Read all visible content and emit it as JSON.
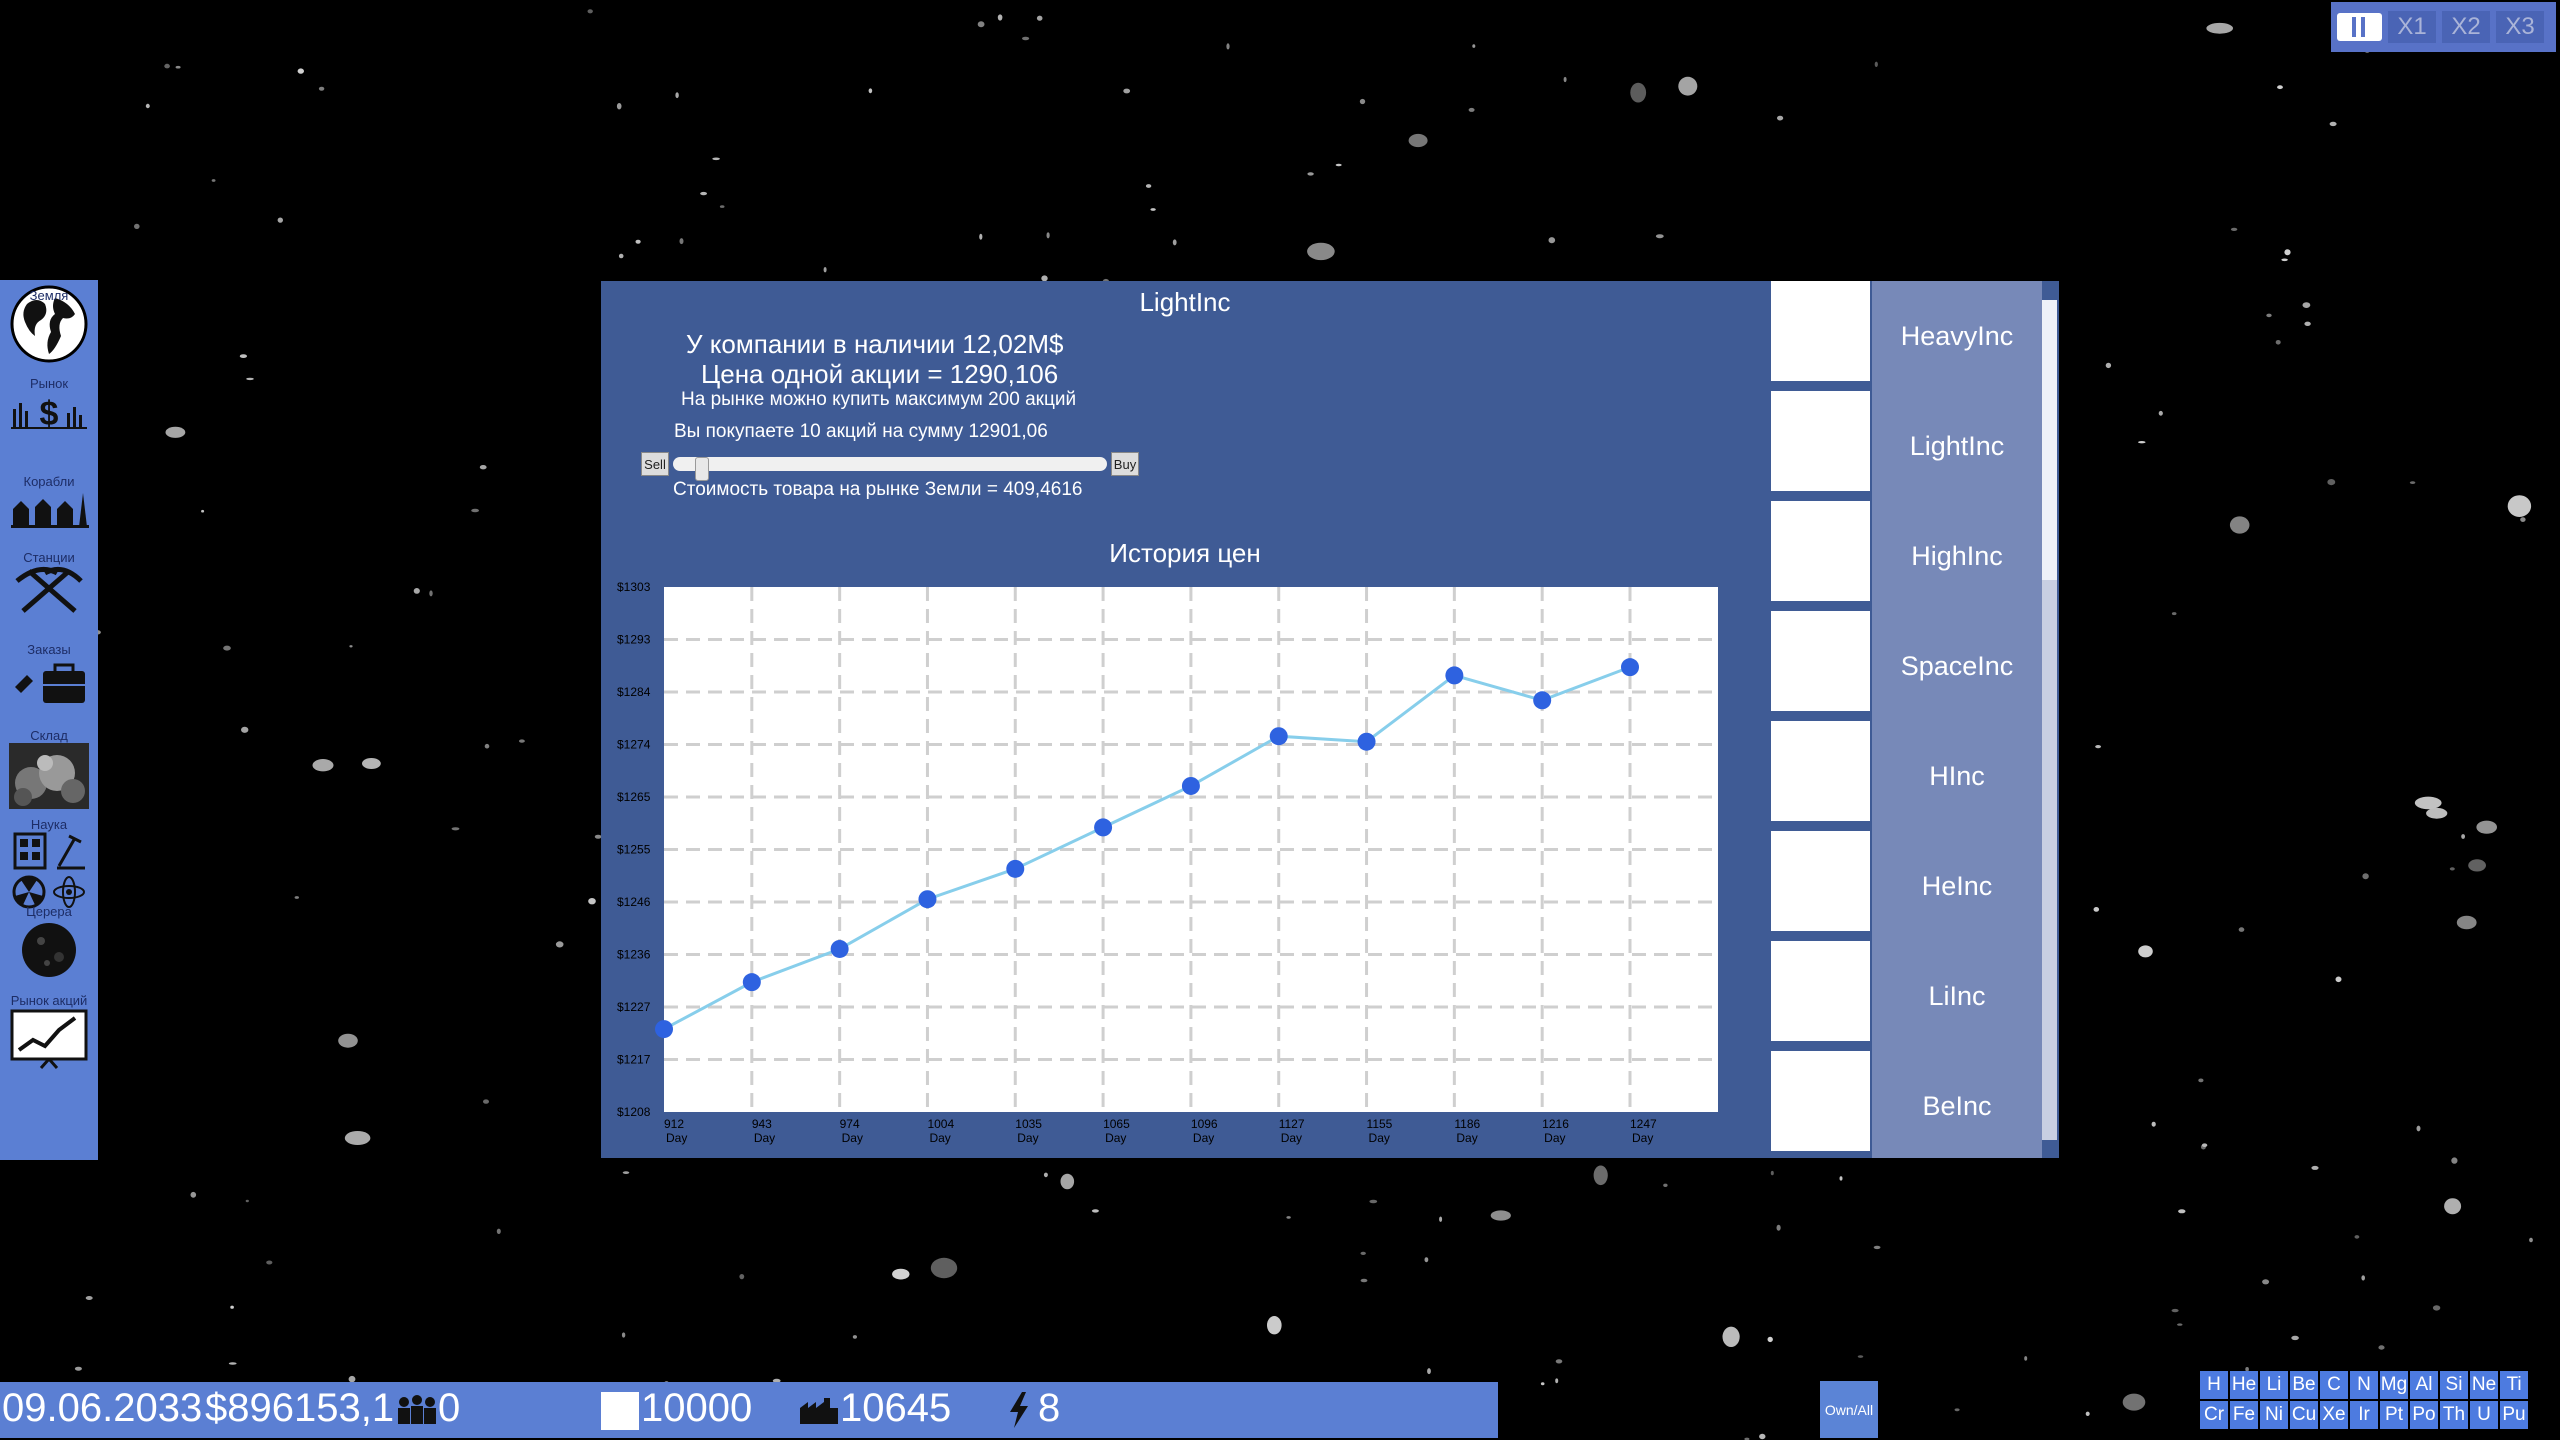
{
  "speed_controls": {
    "pause_icon": "pause-icon",
    "x1": "X1",
    "x2": "X2",
    "x3": "X3"
  },
  "sidebar": {
    "items": [
      {
        "label": "Земля",
        "icon": "globe-icon"
      },
      {
        "label": "Рынок",
        "icon": "market-icon"
      },
      {
        "label": "Корабли",
        "icon": "ships-icon"
      },
      {
        "label": "Станции",
        "icon": "mining-tools-icon"
      },
      {
        "label": "Заказы",
        "icon": "briefcase-icon"
      },
      {
        "label": "Склад",
        "icon": "warehouse-icon"
      },
      {
        "label": "Наука",
        "icon": "science-icon"
      },
      {
        "label": "Церера",
        "icon": "ceres-icon"
      },
      {
        "label": "Рынок акций",
        "icon": "stock-chart-icon"
      }
    ]
  },
  "panel": {
    "title": "LightInc",
    "cash_line": "У компании в наличии 12,02M$",
    "price_line": "Цена одной акции = 1290,106",
    "max_line": "На рынке можно купить максимум 200 акций",
    "buy_line": "Вы покупаете 10 акций на сумму 12901,06",
    "sell_label": "Sell",
    "buy_label": "Buy",
    "slider_fraction": 0.05,
    "earth_line": "Стоимость товара на рынке Земли = 409,4616",
    "chart_title": "История цен"
  },
  "chart_data": {
    "type": "line",
    "title": "История цен",
    "x_ticks": [
      "912",
      "943",
      "974",
      "1004",
      "1035",
      "1065",
      "1096",
      "1127",
      "1155",
      "1186",
      "1216",
      "1247"
    ],
    "x_unit": "Day",
    "y_ticks": [
      "$1208",
      "$1217",
      "$1227",
      "$1236",
      "$1246",
      "$1255",
      "$1265",
      "$1274",
      "$1284",
      "$1293",
      "$1303"
    ],
    "ylim": [
      1208,
      1303
    ],
    "x": [
      912,
      943,
      974,
      1004,
      1035,
      1065,
      1096,
      1127,
      1155,
      1186,
      1216,
      1247
    ],
    "values": [
      1223,
      1231.5,
      1237.5,
      1246.5,
      1252,
      1259.5,
      1267,
      1276,
      1275,
      1287,
      1282.5,
      1288.5
    ],
    "grid": true,
    "line_color": "#87ceeb",
    "point_color": "#2e62e0"
  },
  "companies": [
    "HeavyInc",
    "LightInc",
    "HighInc",
    "SpaceInc",
    "HInc",
    "HeInc",
    "LiInc",
    "BeInc"
  ],
  "bottom_bar": {
    "date": "09.06.2033",
    "money": "$896153,1",
    "crew_icon": "crew-icon",
    "crew": "0",
    "storage_icon": "storage-icon",
    "storage": "10000",
    "factory_icon": "factory-icon",
    "factory": "10645",
    "energy_icon": "lightning-icon",
    "energy": "8"
  },
  "own_all_label": "Own/All",
  "elements_row1": [
    "H",
    "He",
    "Li",
    "Be",
    "C",
    "N",
    "Mg",
    "Al",
    "Si",
    "Ne",
    "Ti"
  ],
  "elements_row2": [
    "Cr",
    "Fe",
    "Ni",
    "Cu",
    "Xe",
    "Ir",
    "Pt",
    "Po",
    "Th",
    "U",
    "Pu"
  ],
  "colors": {
    "ui_blue": "#5b7fd3",
    "panel_blue": "#3f5b95",
    "company_button": "#7789b8"
  }
}
